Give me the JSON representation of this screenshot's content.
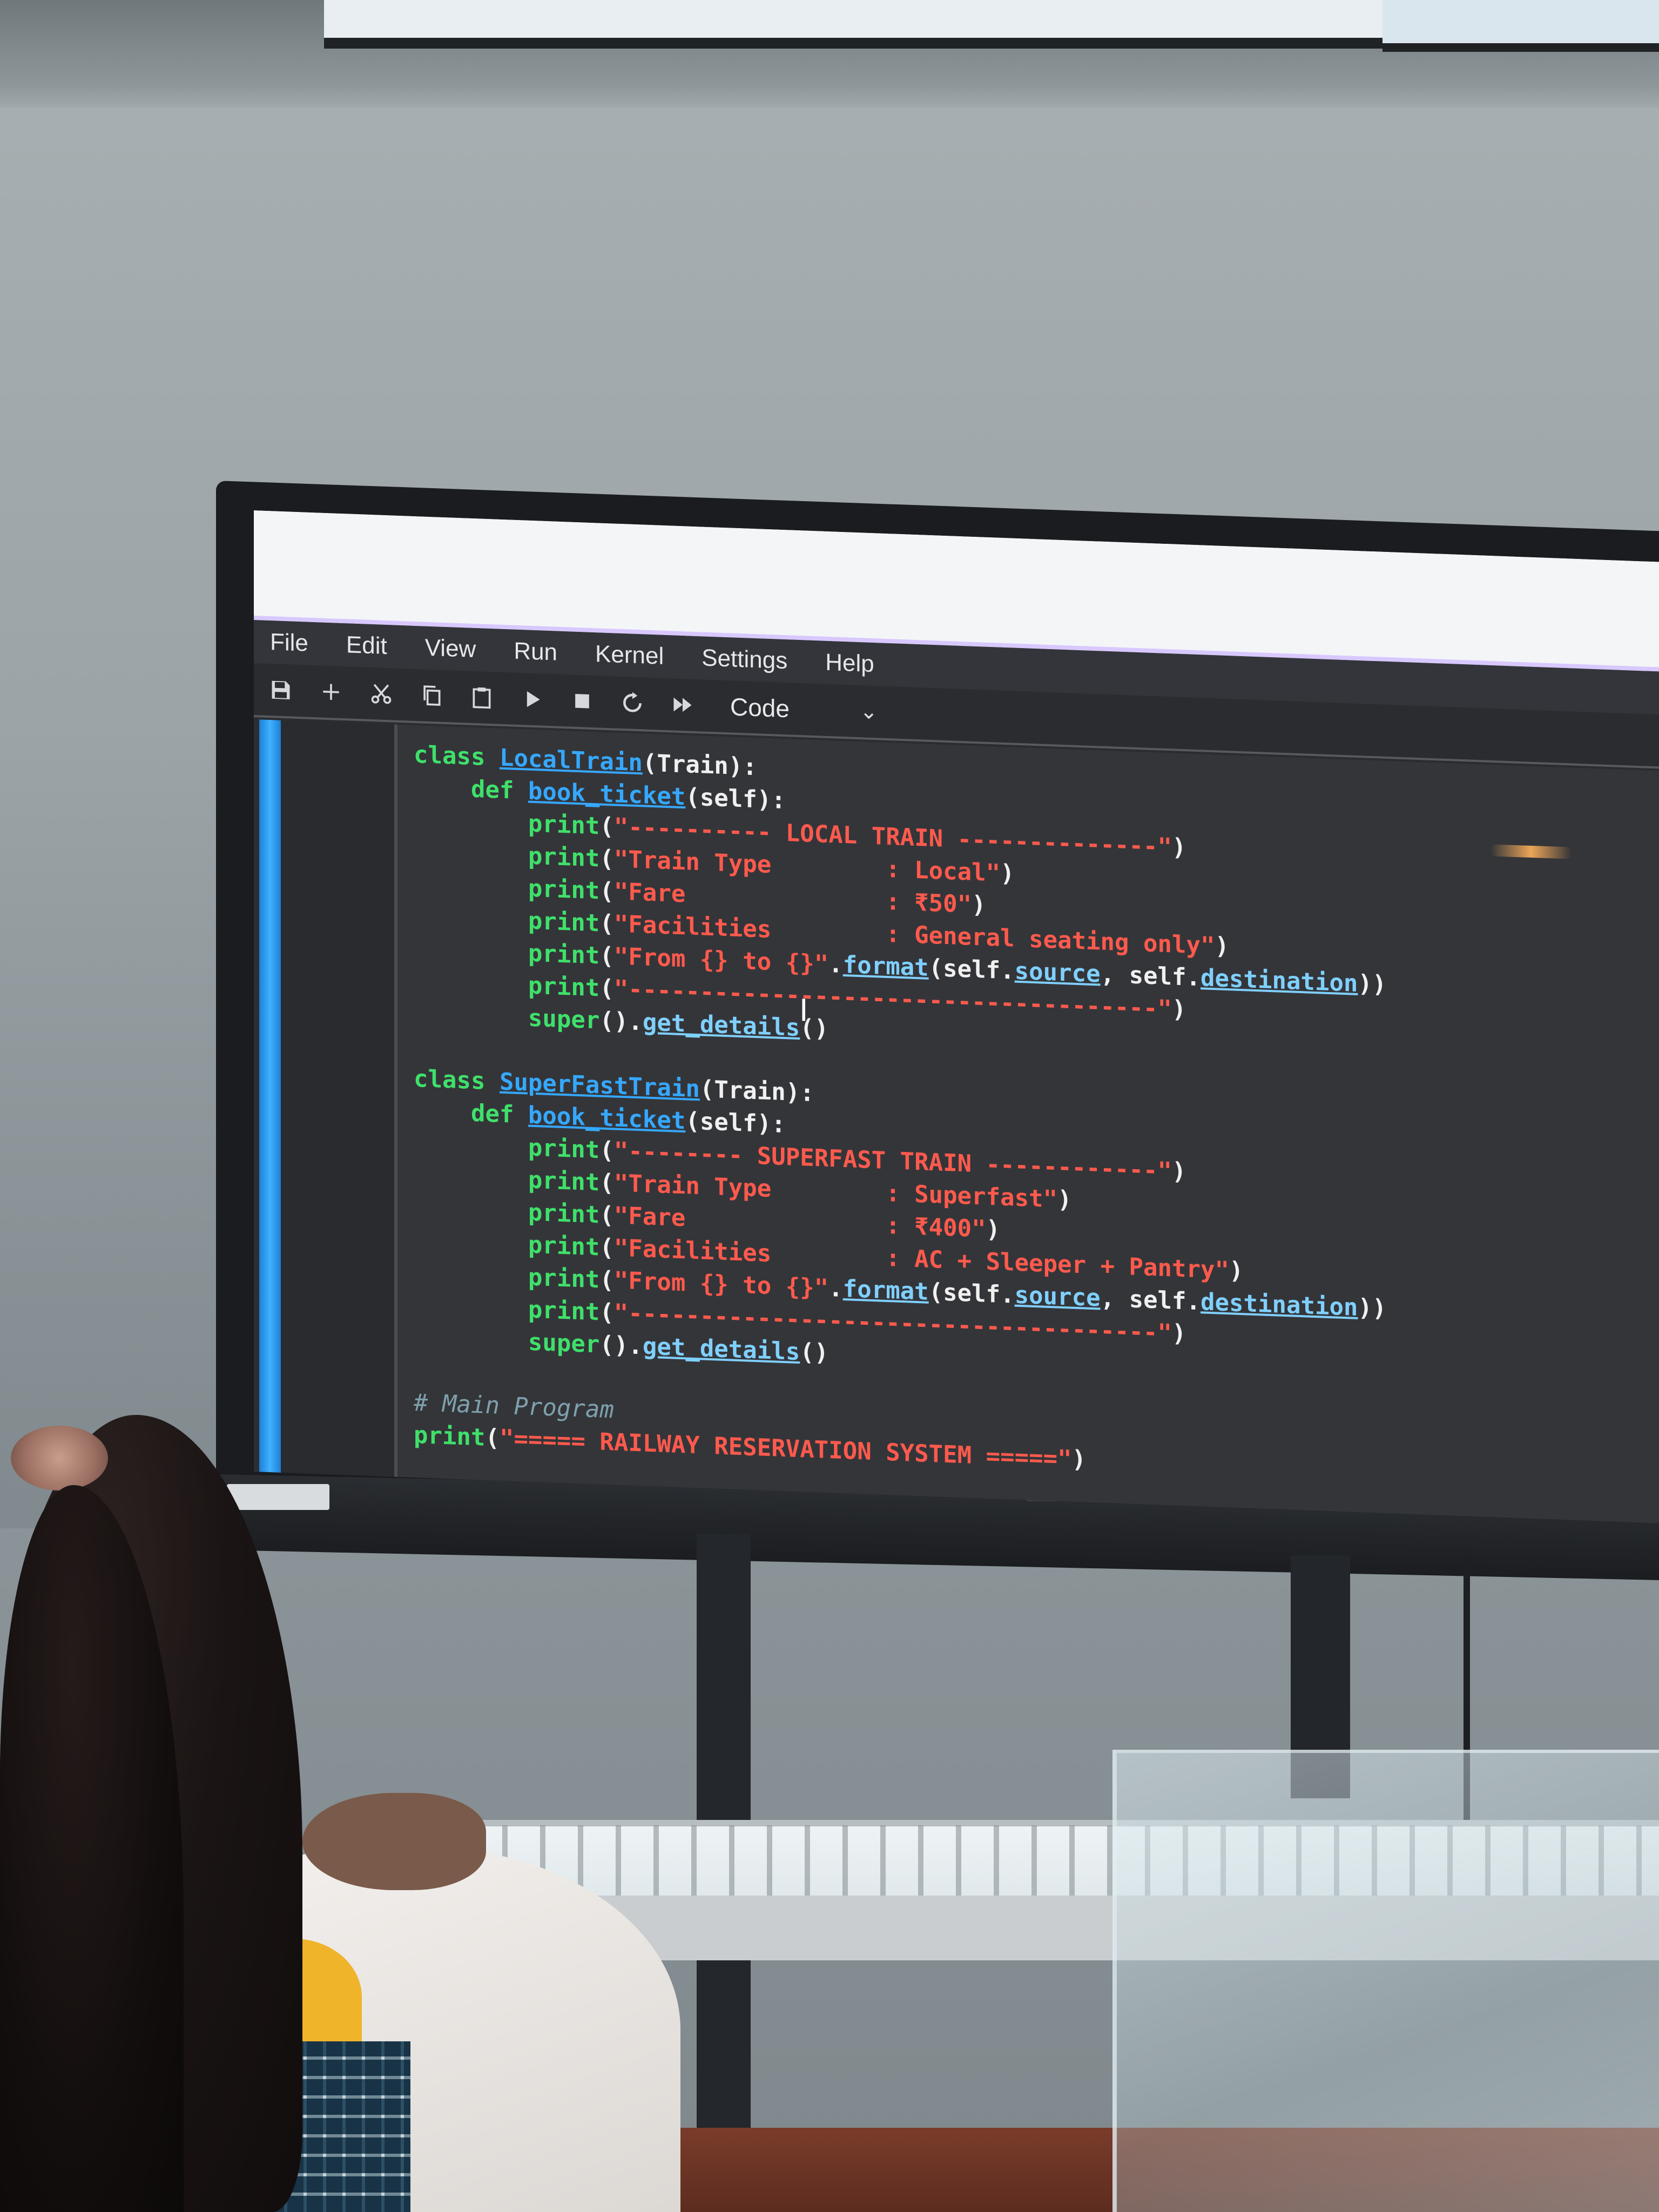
{
  "menu": [
    "File",
    "Edit",
    "View",
    "Run",
    "Kernel",
    "Settings",
    "Help"
  ],
  "toolbar": {
    "tools": [
      "save-icon",
      "add-cell-icon",
      "cut-icon",
      "copy-icon",
      "paste-icon",
      "run-icon",
      "stop-icon",
      "restart-icon",
      "fast-forward-icon"
    ],
    "cell_type": "Code",
    "caret": "⌄"
  },
  "code_lines": [
    [
      {
        "t": "class ",
        "c": "kw"
      },
      {
        "t": "LocalTrain",
        "c": "cls"
      },
      {
        "t": "(Train):",
        "c": "pl"
      }
    ],
    [
      {
        "t": "    def ",
        "c": "kw"
      },
      {
        "t": "book_ticket",
        "c": "fn"
      },
      {
        "t": "(self):",
        "c": "pl"
      }
    ],
    [
      {
        "t": "        print",
        "c": "bi"
      },
      {
        "t": "(",
        "c": "pl"
      },
      {
        "t": "\"---------- LOCAL TRAIN --------------\"",
        "c": "str"
      },
      {
        "t": ")",
        "c": "pl"
      }
    ],
    [
      {
        "t": "        print",
        "c": "bi"
      },
      {
        "t": "(",
        "c": "pl"
      },
      {
        "t": "\"Train Type        : Local\"",
        "c": "str"
      },
      {
        "t": ")",
        "c": "pl"
      }
    ],
    [
      {
        "t": "        print",
        "c": "bi"
      },
      {
        "t": "(",
        "c": "pl"
      },
      {
        "t": "\"Fare              : ₹50\"",
        "c": "str"
      },
      {
        "t": ")",
        "c": "pl"
      }
    ],
    [
      {
        "t": "        print",
        "c": "bi"
      },
      {
        "t": "(",
        "c": "pl"
      },
      {
        "t": "\"Facilities        : General seating only\"",
        "c": "str"
      },
      {
        "t": ")",
        "c": "pl"
      }
    ],
    [
      {
        "t": "        print",
        "c": "bi"
      },
      {
        "t": "(",
        "c": "pl"
      },
      {
        "t": "\"From {} to {}\"",
        "c": "str"
      },
      {
        "t": ".",
        "c": "pl"
      },
      {
        "t": "format",
        "c": "attr"
      },
      {
        "t": "(self.",
        "c": "pl"
      },
      {
        "t": "source",
        "c": "attr"
      },
      {
        "t": ", self.",
        "c": "pl"
      },
      {
        "t": "destination",
        "c": "attr"
      },
      {
        "t": "))",
        "c": "pl"
      }
    ],
    [
      {
        "t": "        print",
        "c": "bi"
      },
      {
        "t": "(",
        "c": "pl"
      },
      {
        "t": "\"-------------------------------------\"",
        "c": "str"
      },
      {
        "t": ")",
        "c": "pl"
      }
    ],
    [
      {
        "t": "        super",
        "c": "bi"
      },
      {
        "t": "().",
        "c": "pl"
      },
      {
        "t": "get_details",
        "c": "attr"
      },
      {
        "t": "()",
        "c": "pl"
      }
    ],
    [
      {
        "t": "",
        "c": "pl"
      }
    ],
    [
      {
        "t": "class ",
        "c": "kw"
      },
      {
        "t": "SuperFastTrain",
        "c": "cls"
      },
      {
        "t": "(Train):",
        "c": "pl"
      }
    ],
    [
      {
        "t": "    def ",
        "c": "kw"
      },
      {
        "t": "book_ticket",
        "c": "fn"
      },
      {
        "t": "(self):",
        "c": "pl"
      }
    ],
    [
      {
        "t": "        print",
        "c": "bi"
      },
      {
        "t": "(",
        "c": "pl"
      },
      {
        "t": "\"-------- SUPERFAST TRAIN ------------\"",
        "c": "str"
      },
      {
        "t": ")",
        "c": "pl"
      }
    ],
    [
      {
        "t": "        print",
        "c": "bi"
      },
      {
        "t": "(",
        "c": "pl"
      },
      {
        "t": "\"Train Type        : Superfast\"",
        "c": "str"
      },
      {
        "t": ")",
        "c": "pl"
      }
    ],
    [
      {
        "t": "        print",
        "c": "bi"
      },
      {
        "t": "(",
        "c": "pl"
      },
      {
        "t": "\"Fare              : ₹400\"",
        "c": "str"
      },
      {
        "t": ")",
        "c": "pl"
      }
    ],
    [
      {
        "t": "        print",
        "c": "bi"
      },
      {
        "t": "(",
        "c": "pl"
      },
      {
        "t": "\"Facilities        : AC + Sleeper + Pantry\"",
        "c": "str"
      },
      {
        "t": ")",
        "c": "pl"
      }
    ],
    [
      {
        "t": "        print",
        "c": "bi"
      },
      {
        "t": "(",
        "c": "pl"
      },
      {
        "t": "\"From {} to {}\"",
        "c": "str"
      },
      {
        "t": ".",
        "c": "pl"
      },
      {
        "t": "format",
        "c": "attr"
      },
      {
        "t": "(self.",
        "c": "pl"
      },
      {
        "t": "source",
        "c": "attr"
      },
      {
        "t": ", self.",
        "c": "pl"
      },
      {
        "t": "destination",
        "c": "attr"
      },
      {
        "t": "))",
        "c": "pl"
      }
    ],
    [
      {
        "t": "        print",
        "c": "bi"
      },
      {
        "t": "(",
        "c": "pl"
      },
      {
        "t": "\"-------------------------------------\"",
        "c": "str"
      },
      {
        "t": ")",
        "c": "pl"
      }
    ],
    [
      {
        "t": "        super",
        "c": "bi"
      },
      {
        "t": "().",
        "c": "pl"
      },
      {
        "t": "get_details",
        "c": "attr"
      },
      {
        "t": "()",
        "c": "pl"
      }
    ],
    [
      {
        "t": "",
        "c": "pl"
      }
    ],
    [
      {
        "t": "# Main Program",
        "c": "cm"
      }
    ],
    [
      {
        "t": "print",
        "c": "bi"
      },
      {
        "t": "(",
        "c": "pl"
      },
      {
        "t": "\"===== RAILWAY RESERVATION SYSTEM =====\"",
        "c": "str"
      },
      {
        "t": ")",
        "c": "pl"
      }
    ]
  ],
  "cursor_glyph": "I"
}
